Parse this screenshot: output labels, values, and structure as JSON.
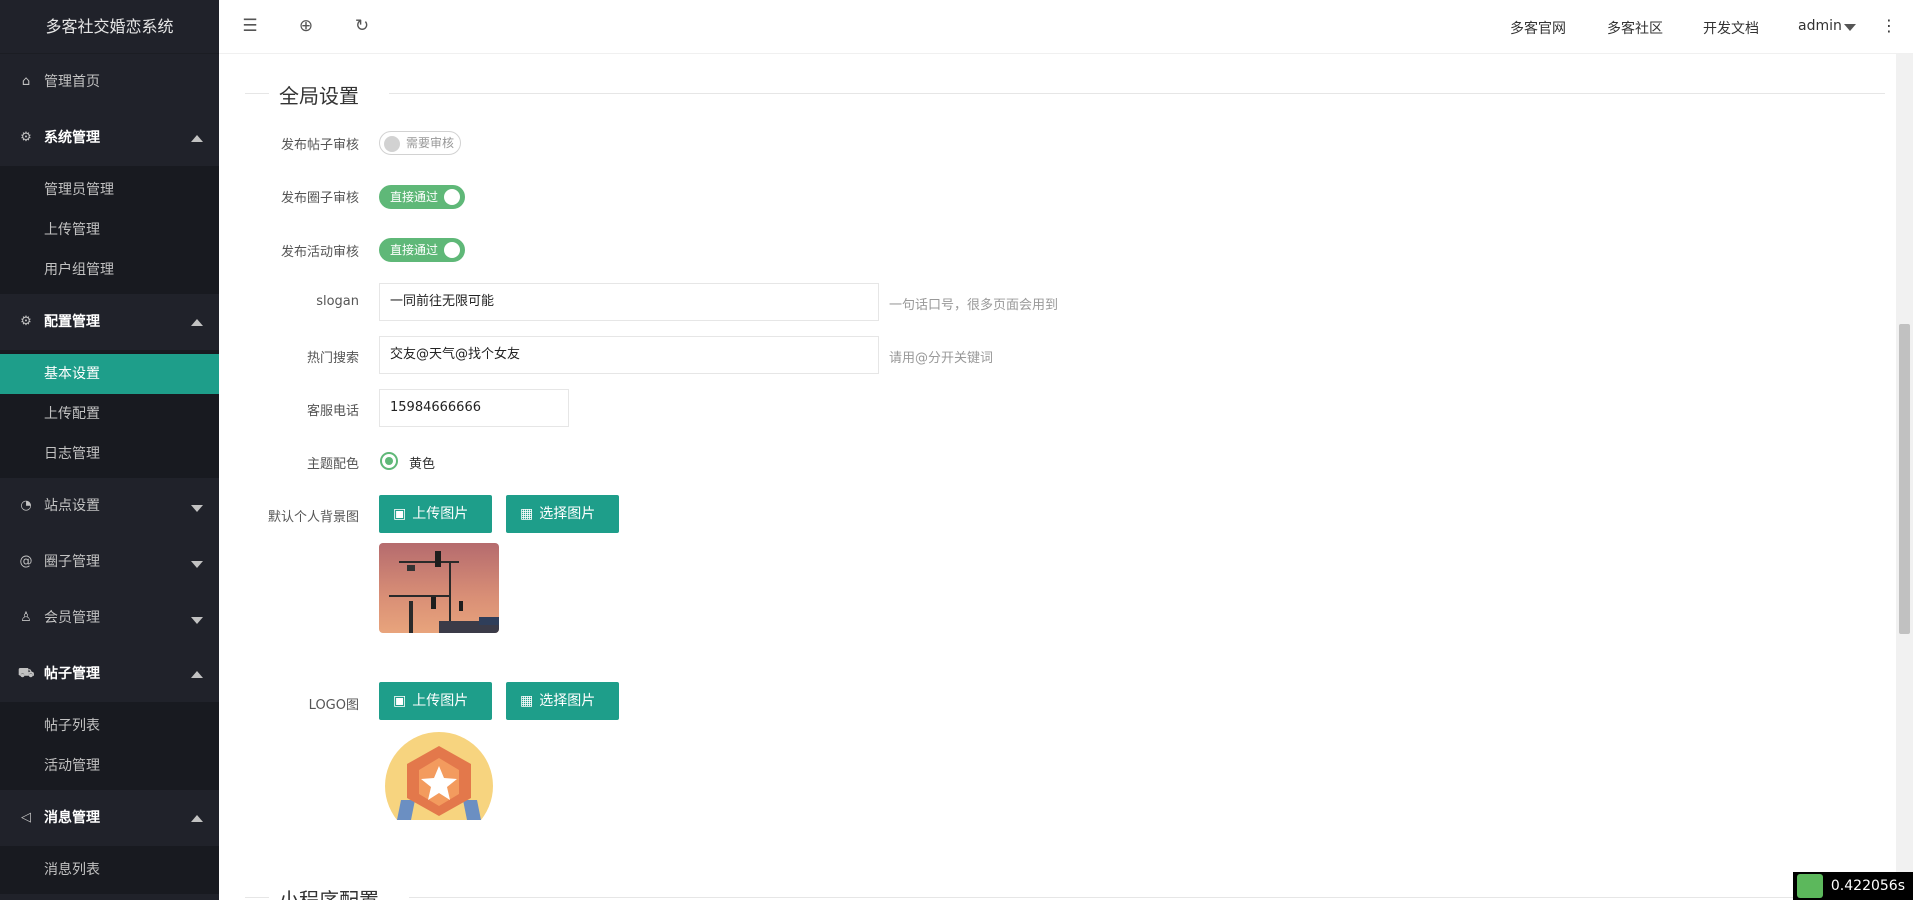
{
  "app": {
    "title": "多客社交婚恋系统"
  },
  "sidebar": {
    "home": {
      "label": "管理首页",
      "icon": "home-icon"
    },
    "groups": [
      {
        "label": "系统管理",
        "icon": "gear-icon",
        "expanded": true,
        "items": [
          "管理员管理",
          "上传管理",
          "用户组管理"
        ]
      },
      {
        "label": "配置管理",
        "icon": "gear-icon",
        "expanded": true,
        "items": [
          "基本设置",
          "上传配置",
          "日志管理"
        ],
        "selected": "基本设置"
      },
      {
        "label": "站点设置",
        "icon": "palette-icon",
        "expanded": false
      },
      {
        "label": "圈子管理",
        "icon": "at-icon",
        "expanded": false
      },
      {
        "label": "会员管理",
        "icon": "user-icon",
        "expanded": false
      },
      {
        "label": "帖子管理",
        "icon": "cart-icon",
        "expanded": true,
        "items": [
          "帖子列表",
          "活动管理"
        ]
      },
      {
        "label": "消息管理",
        "icon": "speaker-icon",
        "expanded": true,
        "items": [
          "消息列表"
        ]
      }
    ]
  },
  "topbar": {
    "links": [
      "多客官网",
      "多客社区",
      "开发文档"
    ],
    "user": "admin"
  },
  "form": {
    "section_title": "全局设置",
    "next_section_title": "小程序配置",
    "post_review": {
      "label": "发布帖子审核",
      "state": "需要审核",
      "on": false
    },
    "circle_review": {
      "label": "发布圈子审核",
      "state": "直接通过",
      "on": true
    },
    "activity_review": {
      "label": "发布活动审核",
      "state": "直接通过",
      "on": true
    },
    "slogan": {
      "label": "slogan",
      "value": "一同前往无限可能",
      "hint": "一句话口号，很多页面会用到"
    },
    "hot_search": {
      "label": "热门搜索",
      "value": "交友@天气@找个女友",
      "hint": "请用@分开关键词"
    },
    "service_phone": {
      "label": "客服电话",
      "value": "15984666666"
    },
    "theme_color": {
      "label": "主题配色",
      "option": "黄色",
      "selected": true
    },
    "bg_image": {
      "label": "默认个人背景图",
      "upload": "上传图片",
      "choose": "选择图片"
    },
    "logo": {
      "label": "LOGO图",
      "upload": "上传图片",
      "choose": "选择图片"
    }
  },
  "footer": {
    "timer": "0.422056s"
  },
  "colors": {
    "accent": "#1e9e8a",
    "switch_on": "#5fb878",
    "sidebar_bg": "#20222a"
  }
}
